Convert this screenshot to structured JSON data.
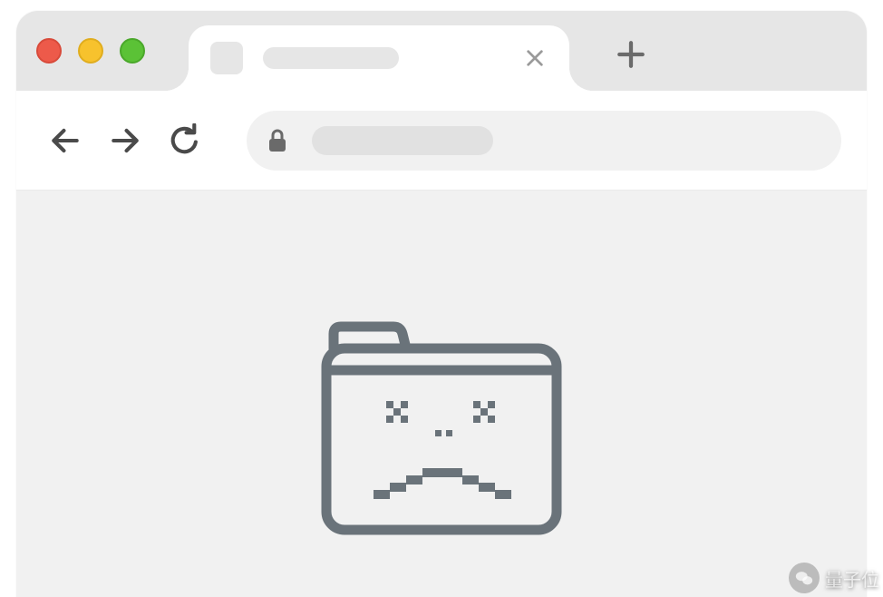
{
  "window": {
    "traffic_lights": {
      "close": "red",
      "minimize": "yellow",
      "maximize": "green"
    }
  },
  "tabs": {
    "active": {
      "title_placeholder": "",
      "favicon_placeholder": ""
    },
    "new_tab_icon": "plus-icon",
    "close_icon": "close-icon"
  },
  "toolbar": {
    "back_icon": "arrow-left-icon",
    "forward_icon": "arrow-right-icon",
    "reload_icon": "reload-icon",
    "omnibox": {
      "secure_icon": "lock-icon",
      "url_placeholder": ""
    }
  },
  "content": {
    "error_icon": "dead-folder-icon"
  },
  "watermark": {
    "source_label": "量子位",
    "logo_icon": "wechat-icon"
  }
}
